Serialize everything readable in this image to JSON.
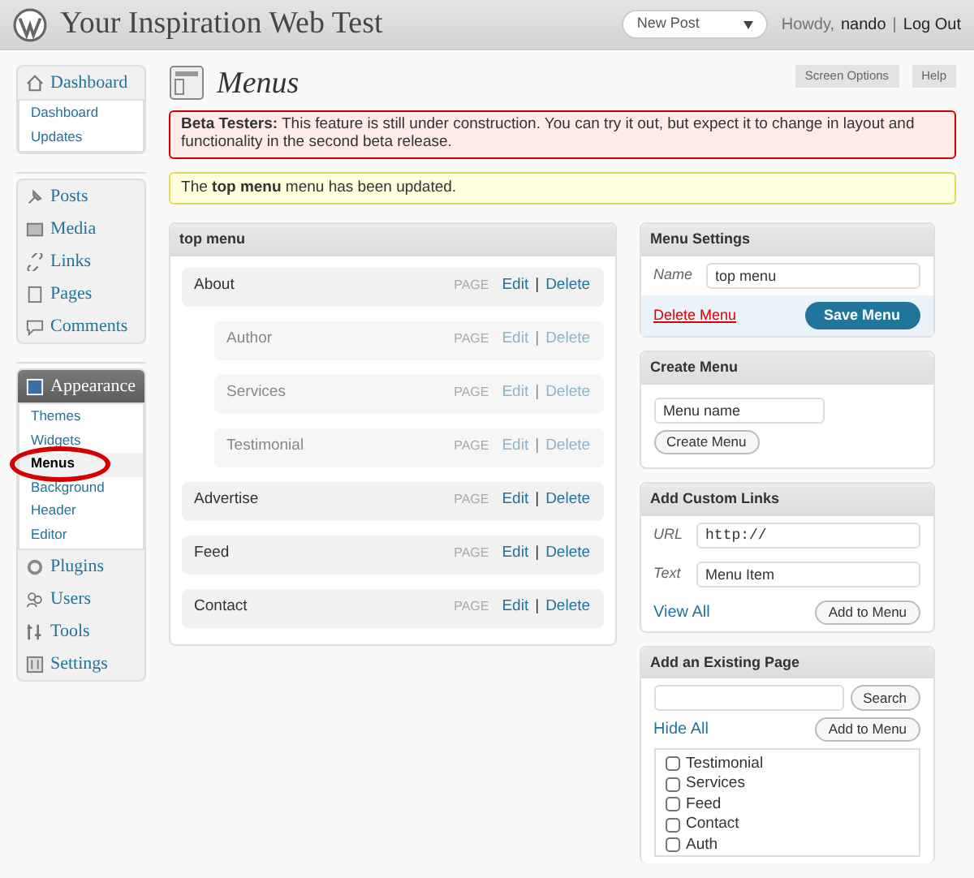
{
  "header": {
    "site_title": "Your Inspiration Web Test",
    "action_dropdown": "New Post",
    "greeting": "Howdy,",
    "user": "nando",
    "separator": "|",
    "logout": "Log Out"
  },
  "screen_tabs": [
    {
      "label": "Screen Options"
    },
    {
      "label": "Help"
    }
  ],
  "sidebar": {
    "sections": [
      [
        {
          "label": "Dashboard",
          "expanded": true,
          "selected": false,
          "children": [
            {
              "label": "Dashboard",
              "selected": false,
              "circled": false
            },
            {
              "label": "Updates",
              "selected": false,
              "circled": false
            }
          ]
        }
      ],
      [
        {
          "label": "Posts",
          "selected": false
        },
        {
          "label": "Media",
          "selected": false
        },
        {
          "label": "Links",
          "selected": false
        },
        {
          "label": "Pages",
          "selected": false
        },
        {
          "label": "Comments",
          "selected": false
        }
      ],
      [
        {
          "label": "Appearance",
          "expanded": true,
          "selected": true,
          "children": [
            {
              "label": "Themes",
              "selected": false,
              "circled": false
            },
            {
              "label": "Widgets",
              "selected": false,
              "circled": false
            },
            {
              "label": "Menus",
              "selected": true,
              "circled": true
            },
            {
              "label": "Background",
              "selected": false,
              "circled": false
            },
            {
              "label": "Header",
              "selected": false,
              "circled": false
            },
            {
              "label": "Editor",
              "selected": false,
              "circled": false
            }
          ]
        },
        {
          "label": "Plugins",
          "selected": false
        },
        {
          "label": "Users",
          "selected": false
        },
        {
          "label": "Tools",
          "selected": false
        },
        {
          "label": "Settings",
          "selected": false
        }
      ]
    ]
  },
  "page": {
    "title": "Menus",
    "notices": [
      {
        "kind": "error",
        "text": "**Beta Testers:** This feature is still under construction. You can try it out, but expect it to change in layout and functionality in the second beta release."
      },
      {
        "kind": "updated",
        "text": "The **top menu** menu has been updated."
      }
    ]
  },
  "menu_editor": {
    "title": "top menu",
    "items": [
      {
        "label": "About",
        "type": "PAGE",
        "edit": "Edit",
        "sep": "|",
        "delete": "Delete",
        "children": [
          {
            "label": "Author",
            "type": "PAGE",
            "edit": "Edit",
            "sep": "|",
            "delete": "Delete"
          },
          {
            "label": "Services",
            "type": "PAGE",
            "edit": "Edit",
            "sep": "|",
            "delete": "Delete"
          },
          {
            "label": "Testimonial",
            "type": "PAGE",
            "edit": "Edit",
            "sep": "|",
            "delete": "Delete"
          }
        ]
      },
      {
        "label": "Advertise",
        "type": "PAGE",
        "edit": "Edit",
        "sep": "|",
        "delete": "Delete"
      },
      {
        "label": "Feed",
        "type": "PAGE",
        "edit": "Edit",
        "sep": "|",
        "delete": "Delete"
      },
      {
        "label": "Contact",
        "type": "PAGE",
        "edit": "Edit",
        "sep": "|",
        "delete": "Delete"
      }
    ]
  },
  "menu_settings": {
    "title": "Menu Settings",
    "name_label": "Name",
    "name_value": "top menu",
    "delete_link": "Delete Menu",
    "save_button": "Save Menu"
  },
  "create_menu": {
    "title": "Create Menu",
    "name_value": "Menu name",
    "button": "Create Menu"
  },
  "custom_links": {
    "title": "Add Custom Links",
    "url_label": "URL",
    "url_value": "http://",
    "text_label": "Text",
    "text_value": "Menu Item",
    "view_all": "View All",
    "add_button": "Add to Menu"
  },
  "existing_page": {
    "title": "Add an Existing Page",
    "search_button": "Search",
    "hide_all": "Hide All",
    "add_button": "Add to Menu",
    "pages": [
      {
        "label": "Testimonial",
        "checked": false
      },
      {
        "label": "Services",
        "checked": false
      },
      {
        "label": "Feed",
        "checked": false
      },
      {
        "label": "Contact",
        "checked": false
      },
      {
        "label": "Auth",
        "checked": false
      }
    ]
  }
}
